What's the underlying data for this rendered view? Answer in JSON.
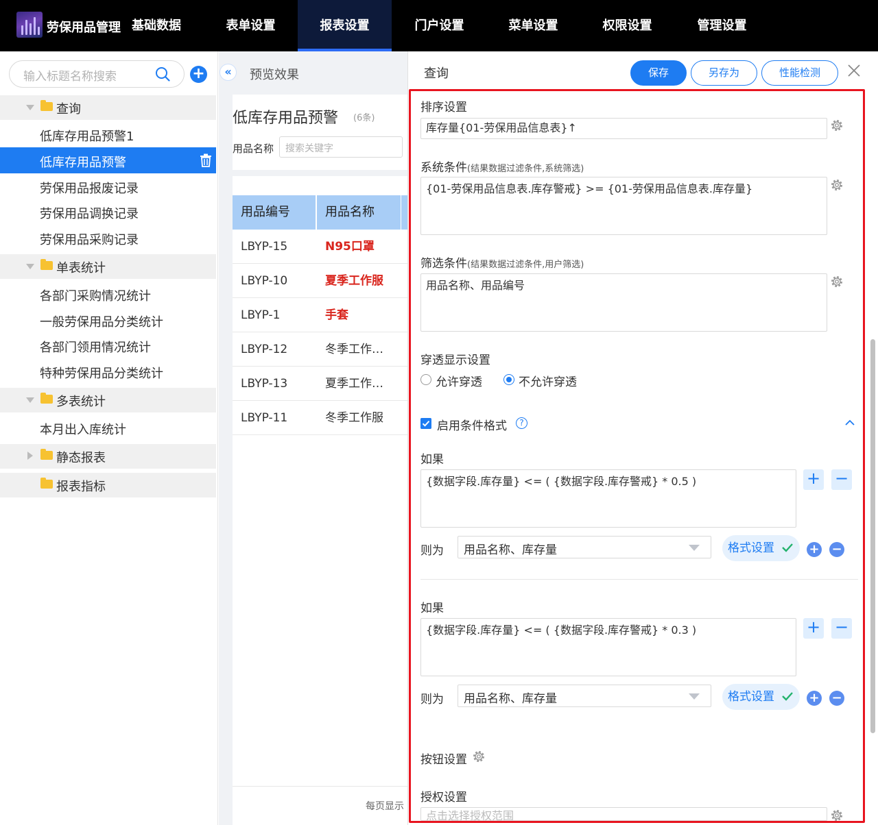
{
  "header": {
    "app_title": "劳保用品管理",
    "nav": [
      {
        "label": "基础数据"
      },
      {
        "label": "表单设置"
      },
      {
        "label": "报表设置",
        "active": true
      },
      {
        "label": "门户设置"
      },
      {
        "label": "菜单设置"
      },
      {
        "label": "权限设置"
      },
      {
        "label": "管理设置"
      }
    ]
  },
  "sidebar": {
    "search_placeholder": "输入标题名称搜索",
    "groups": [
      {
        "label": "查询",
        "items": [
          "低库存用品预警1",
          "低库存用品预警",
          "劳保用品报废记录",
          "劳保用品调换记录",
          "劳保用品采购记录"
        ]
      },
      {
        "label": "单表统计",
        "items": [
          "各部门采购情况统计",
          "一般劳保用品分类统计",
          "各部门领用情况统计",
          "特种劳保用品分类统计"
        ]
      },
      {
        "label": "多表统计",
        "items": [
          "本月出入库统计"
        ]
      },
      {
        "label": "静态报表",
        "items": []
      },
      {
        "label": "报表指标",
        "items": []
      }
    ],
    "active_item": "低库存用品预警"
  },
  "preview": {
    "header": "预览效果",
    "title": "低库存用品预警",
    "count": "(6条)",
    "filter_label": "用品名称",
    "filter_placeholder": "搜索关键字",
    "columns": [
      "用品编号",
      "用品名称"
    ],
    "rows": [
      {
        "code": "LBYP-15",
        "name": "N95口罩",
        "highlight": true
      },
      {
        "code": "LBYP-10",
        "name": "夏季工作服",
        "highlight": true
      },
      {
        "code": "LBYP-1",
        "name": "手套",
        "highlight": true
      },
      {
        "code": "LBYP-12",
        "name": "冬季工作…",
        "highlight": false
      },
      {
        "code": "LBYP-13",
        "name": "夏季工作…",
        "highlight": false
      },
      {
        "code": "LBYP-11",
        "name": "冬季工作服",
        "highlight": false
      }
    ],
    "footer": "每页显示"
  },
  "panel": {
    "title": "查询",
    "save": "保存",
    "save_as": "另存为",
    "perf_check": "性能检测",
    "sort_label": "排序设置",
    "sort_value": "库存量{01-劳保用品信息表}↑",
    "system_label": "系统条件",
    "system_hint": "(结果数据过滤条件,系统筛选)",
    "system_value": "{01-劳保用品信息表.库存警戒} >= {01-劳保用品信息表.库存量}",
    "filter_label": "筛选条件",
    "filter_hint": "(结果数据过滤条件,用户筛选)",
    "filter_value": "用品名称、用品编号",
    "drill_label": "穿透显示设置",
    "drill_allow": "允许穿透",
    "drill_deny": "不允许穿透",
    "cond_format_label": "启用条件格式",
    "help": "?",
    "rules": [
      {
        "if_label": "如果",
        "expr": "{数据字段.库存量} <= ( {数据字段.库存警戒} * 0.5 )",
        "then_label": "则为",
        "target": "用品名称、库存量",
        "format_btn": "格式设置"
      },
      {
        "if_label": "如果",
        "expr": "{数据字段.库存量} <= ( {数据字段.库存警戒} * 0.3 )",
        "then_label": "则为",
        "target": "用品名称、库存量",
        "format_btn": "格式设置"
      }
    ],
    "button_settings": "按钮设置",
    "auth_label": "授权设置",
    "auth_placeholder": "点击选择授权范围"
  },
  "colors": {
    "accent": "#1e7cf2",
    "highlight_text": "#d9251d",
    "frame": "#e8141f"
  }
}
